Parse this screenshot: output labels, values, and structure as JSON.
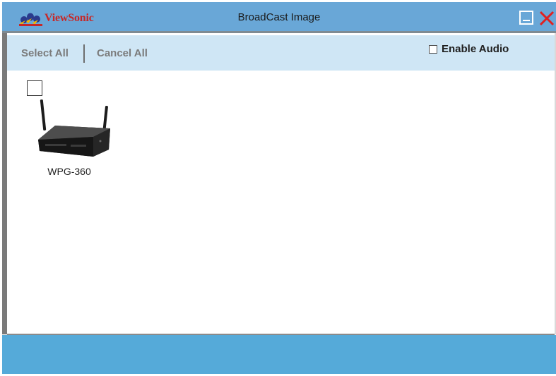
{
  "window": {
    "title": "BroadCast  Image",
    "logo_text": "ViewSonic",
    "minimize_icon": "minimize-icon",
    "close_icon": "close-icon",
    "close_color": "#e02020"
  },
  "toolbar": {
    "select_all": "Select All",
    "cancel_all": "Cancel All",
    "enable_audio_label": "Enable Audio",
    "enable_audio_checked": false
  },
  "devices": [
    {
      "name": "WPG-360",
      "checked": false,
      "icon": "wireless-router-icon"
    }
  ],
  "colors": {
    "titlebar": "#69a7d7",
    "toolbar": "#cfe6f5",
    "footer": "#55aad9",
    "logo": "#c62828"
  }
}
